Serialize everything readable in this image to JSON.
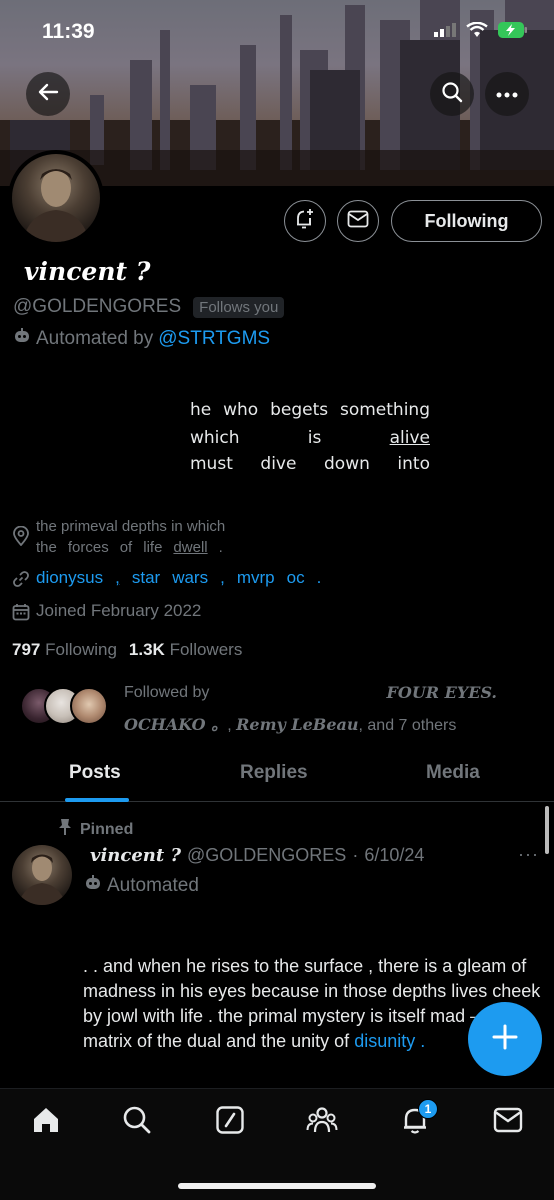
{
  "status_bar": {
    "time": "11:39"
  },
  "profile": {
    "display_name": "vincent ?",
    "handle": "@GOLDENGORES",
    "follows_you": "Follows you",
    "automated_prefix": "Automated by",
    "automated_by": "@STRTGMS",
    "following_button": "Following",
    "bio_lines": [
      [
        "he",
        "who",
        "begets",
        "something"
      ],
      [
        "which",
        "is",
        "alive"
      ],
      [
        "must",
        "dive",
        "down",
        "into"
      ]
    ],
    "location_line1": "the primeval depths in which",
    "location_line2": [
      "the",
      "forces",
      "of",
      "life",
      "dwell",
      "."
    ],
    "website_parts": [
      "dionysus",
      ",",
      "star",
      "wars",
      ",",
      "mvrp",
      "oc",
      "."
    ],
    "joined": "Joined February 2022",
    "following_count": "797",
    "following_label": "Following",
    "followers_count": "1.3K",
    "followers_label": "Followers",
    "followed_by_prefix": "Followed by",
    "followed_by_name1": "FOUR EYES.",
    "followed_by_name2": "OCHAKO 。",
    "followed_by_name3": "Remy LeBeau",
    "followed_by_suffix": ", and 7 others"
  },
  "tabs": [
    "Posts",
    "Replies",
    "Media"
  ],
  "pinned_post": {
    "pinned_label": "Pinned",
    "author_name": "vincent ?",
    "author_handle": "@GOLDENGORES",
    "separator": "·",
    "date": "6/10/24",
    "more": "···",
    "automated_label": "Automated",
    "text": ". . and when he rises to the surface , there is a gleam of madness in his eyes because in those depths lives cheek by jowl with life . the primal mystery is itself mad — the matrix of the dual and the unity of",
    "text_link": "disunity",
    "text_end": " ."
  },
  "bottom_nav": {
    "items": [
      "home-icon",
      "search-icon",
      "grok-icon",
      "communities-icon",
      "notifications-icon",
      "messages-icon"
    ],
    "notification_badge": "1"
  },
  "colors": {
    "accent": "#1d9bf0",
    "muted": "#71767b",
    "text": "#e7e9ea",
    "background": "#000000"
  }
}
